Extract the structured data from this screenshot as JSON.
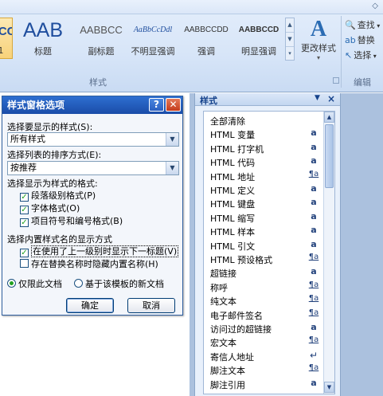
{
  "ribbon": {
    "collapse_glyph": "◇",
    "gallery": [
      {
        "sample": "BCC",
        "name": "1",
        "selected": true
      },
      {
        "sample": "AAB",
        "name": "标题"
      },
      {
        "sample": "AABBCC",
        "name": "副标题"
      },
      {
        "sample": "AaBbCcDdl",
        "name": "不明显强调"
      },
      {
        "sample": "AABBCCDD",
        "name": "强调"
      },
      {
        "sample": "AABBCCD",
        "name": "明显强调"
      }
    ],
    "change_styles_label": "更改样式",
    "change_styles_glyph": "A",
    "editing": {
      "find": "查找",
      "replace": "替换",
      "select": "选择"
    },
    "group_styles_label": "样式",
    "group_editing_label": "编辑"
  },
  "dialog": {
    "title": "样式窗格选项",
    "help": "?",
    "close": "✕",
    "select_styles_label": "选择要显示的样式(S):",
    "select_styles_value": "所有样式",
    "sort_label": "选择列表的排序方式(E):",
    "sort_value": "按推荐",
    "format_label": "选择显示为样式的格式:",
    "format_options": [
      {
        "label": "段落级别格式(P)",
        "checked": true
      },
      {
        "label": "字体格式(O)",
        "checked": true
      },
      {
        "label": "项目符号和编号格式(B)",
        "checked": true
      }
    ],
    "builtin_label": "选择内置样式名的显示方式",
    "builtin_options": [
      {
        "label": "在使用了上一级别时显示下一标题(V)",
        "checked": true
      },
      {
        "label": "存在替换名称时隐藏内置名称(H)",
        "checked": false
      }
    ],
    "scope": [
      {
        "label": "仅限此文档",
        "selected": true
      },
      {
        "label": "基于该模板的新文档",
        "selected": false
      }
    ],
    "ok": "确定",
    "cancel": "取消"
  },
  "styles_pane": {
    "title": "样式",
    "menu_glyph": "▼",
    "close_glyph": "×",
    "items": [
      {
        "name": "全部清除",
        "type": ""
      },
      {
        "name": "HTML 变量",
        "type": "a"
      },
      {
        "name": "HTML 打字机",
        "type": "a"
      },
      {
        "name": "HTML 代码",
        "type": "a"
      },
      {
        "name": "HTML 地址",
        "type": "¶a"
      },
      {
        "name": "HTML 定义",
        "type": "a"
      },
      {
        "name": "HTML 键盘",
        "type": "a"
      },
      {
        "name": "HTML 缩写",
        "type": "a"
      },
      {
        "name": "HTML 样本",
        "type": "a"
      },
      {
        "name": "HTML 引文",
        "type": "a"
      },
      {
        "name": "HTML 预设格式",
        "type": "¶a"
      },
      {
        "name": "超链接",
        "type": "a"
      },
      {
        "name": "称呼",
        "type": "¶a"
      },
      {
        "name": "纯文本",
        "type": "¶a"
      },
      {
        "name": "电子邮件签名",
        "type": "¶a"
      },
      {
        "name": "访问过的超链接",
        "type": "a"
      },
      {
        "name": "宏文本",
        "type": "¶a"
      },
      {
        "name": "寄信人地址",
        "type": "↵"
      },
      {
        "name": "脚注文本",
        "type": "¶a"
      },
      {
        "name": "脚注引用",
        "type": "a"
      }
    ]
  }
}
